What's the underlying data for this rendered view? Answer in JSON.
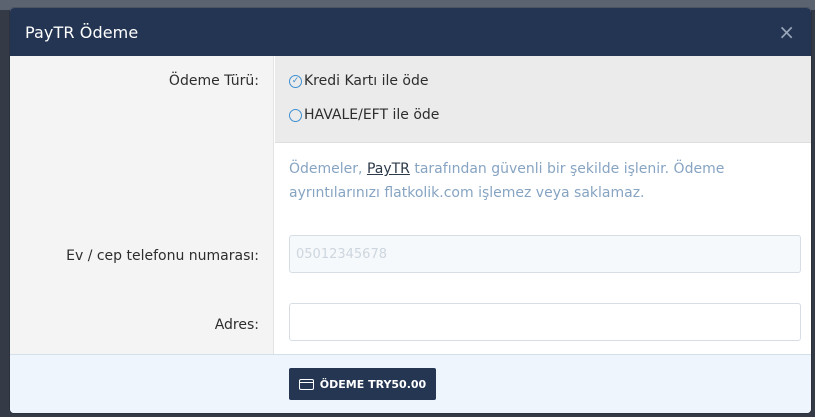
{
  "modal": {
    "title": "PayTR Ödeme",
    "close_glyph": "×"
  },
  "form": {
    "payment_type_label": "Ödeme Türü:",
    "options": [
      {
        "label": "Kredi Kartı ile öde",
        "selected": true
      },
      {
        "label": "HAVALE/EFT ile öde",
        "selected": false
      }
    ],
    "info": {
      "prefix": "Ödemeler, ",
      "link": "PayTR",
      "suffix": " tarafından güvenli bir şekilde işlenir. Ödeme ayrıntılarınızı flatkolik.com işlemez veya saklamaz."
    },
    "phone": {
      "label": "Ev / cep telefonu numarası:",
      "value": "",
      "placeholder": "05012345678"
    },
    "address": {
      "label": "Adres:",
      "value": "",
      "placeholder": ""
    }
  },
  "footer": {
    "pay_button_label": "ÖDEME TRY50.00",
    "pay_button_icon": "credit-card-icon"
  },
  "colors": {
    "header_bg": "#233553",
    "accent_blue": "#3f8fd2",
    "button_bg": "#243652",
    "footer_bg": "#eef5fc"
  }
}
